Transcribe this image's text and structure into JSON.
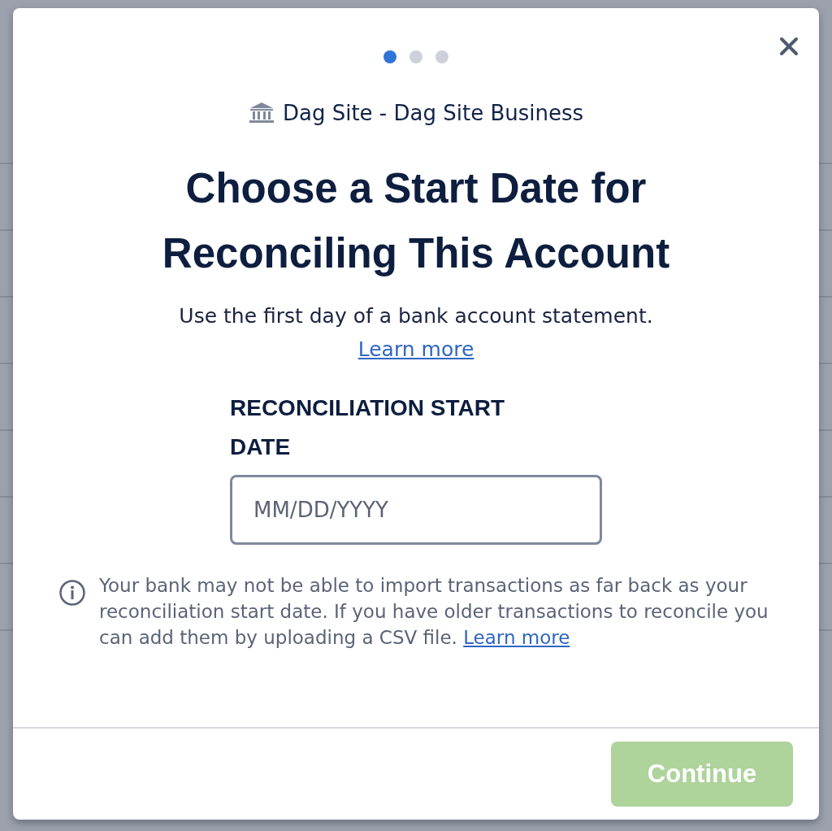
{
  "steps": [
    {
      "selected": true
    },
    {
      "selected": false
    },
    {
      "selected": false
    }
  ],
  "account": "Dag Site - Dag Site Business",
  "title": "Choose a Start Date for Reconciling This Account",
  "subtitle": "Use the first day of a bank account statement.",
  "learn_more": "Learn more",
  "date_field": {
    "label": "RECONCILIATION START DATE",
    "placeholder": "MM/DD/YYYY"
  },
  "notice": {
    "text": "Your bank may not be able to import transactions as far back as your reconciliation start date. If you have older transactions to reconcile you can add them by uploading a CSV file.",
    "link": "Learn more"
  },
  "continue_button": {
    "label": "Continue",
    "disabled": true
  }
}
